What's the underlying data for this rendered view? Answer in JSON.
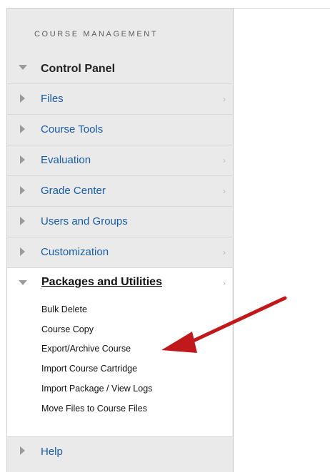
{
  "sidebar": {
    "section_heading": "COURSE MANAGEMENT",
    "control_panel": "Control Panel",
    "items": [
      {
        "label": "Files",
        "chevron": "›"
      },
      {
        "label": "Course Tools",
        "chevron": ""
      },
      {
        "label": "Evaluation",
        "chevron": "›"
      },
      {
        "label": "Grade Center",
        "chevron": "›"
      },
      {
        "label": "Users and Groups",
        "chevron": ""
      },
      {
        "label": "Customization",
        "chevron": "›"
      },
      {
        "label": "Packages and Utilities",
        "chevron": "›"
      }
    ],
    "sub_items": [
      "Bulk Delete",
      "Course Copy",
      "Export/Archive Course",
      "Import Course Cartridge",
      "Import Package / View Logs",
      "Move Files to Course Files"
    ],
    "help": "Help"
  },
  "colors": {
    "link": "#175ca6",
    "panel_bg": "#eaeaea",
    "annotation_arrow": "#c0181b"
  },
  "icons": {
    "expand": "triangle-right-icon",
    "collapse": "triangle-down-icon",
    "chevron": "chevron-right-icon",
    "annotation": "red-arrow-icon"
  }
}
